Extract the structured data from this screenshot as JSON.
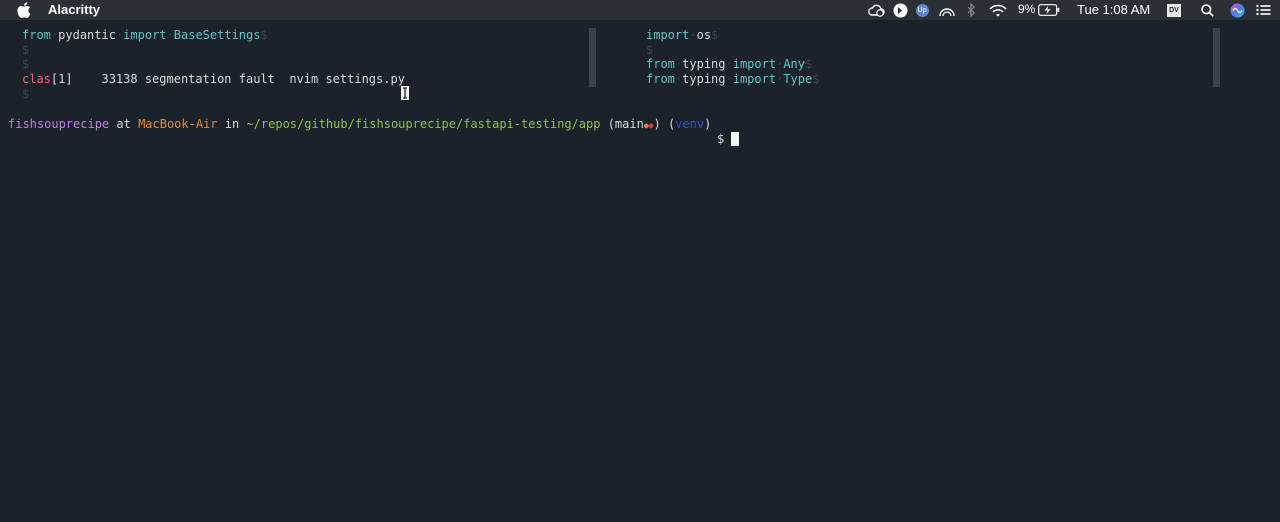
{
  "menubar": {
    "app_name": "Alacritty",
    "battery_percent": "9%",
    "clock": "Tue 1:08 AM",
    "up_badge": "Up",
    "dv_badge": "DV",
    "icons": [
      "apple-logo-icon",
      "creative-cloud-icon",
      "backblaze-icon",
      "upnote-icon",
      "arc-gauge-icon",
      "bluetooth-icon",
      "wifi-icon",
      "battery-icon",
      "dv-icon",
      "spotlight-icon",
      "siri-icon",
      "control-center-icon"
    ]
  },
  "left_pane": {
    "line1": {
      "kw1": "from",
      "mod": "pydantic",
      "kw2": "import",
      "cls": "BaseSettings",
      "eol": "$"
    },
    "line2": "$",
    "line3": "$",
    "line4": {
      "prefix": "clas",
      "rest": "[1]    33138 segmentation fault  nvim settings.py"
    },
    "line5": "$"
  },
  "right_pane": {
    "line1": {
      "kw": "import",
      "mod": "os",
      "eol": "$"
    },
    "line2": "$",
    "line3": {
      "kw1": "from",
      "mod": "typing",
      "kw2": "import",
      "cls": "Any",
      "eol": "$"
    },
    "line4": {
      "kw1": "from",
      "mod": "typing",
      "kw2": "import",
      "cls": "Type",
      "eol": "$"
    }
  },
  "prompt": {
    "user": "fishsouprecipe",
    "at": " at ",
    "host": "MacBook-Air",
    "in": " in ",
    "path": "~/repos/github/fishsouprecipe/fastapi-testing/app",
    "branch_open": " (",
    "branch": "main",
    "dot1": "●",
    "dot2": "●",
    "branch_close": ")",
    "venv_open": " (",
    "venv": "venv",
    "venv_close": ")",
    "symbol": "$"
  },
  "colors": {
    "background": "#1b2229",
    "keyword": "#5fc4cc",
    "error": "#f0607a",
    "user": "#c37ee6",
    "host": "#e8862f",
    "path": "#8cc34a",
    "venv": "#2a55c9"
  }
}
